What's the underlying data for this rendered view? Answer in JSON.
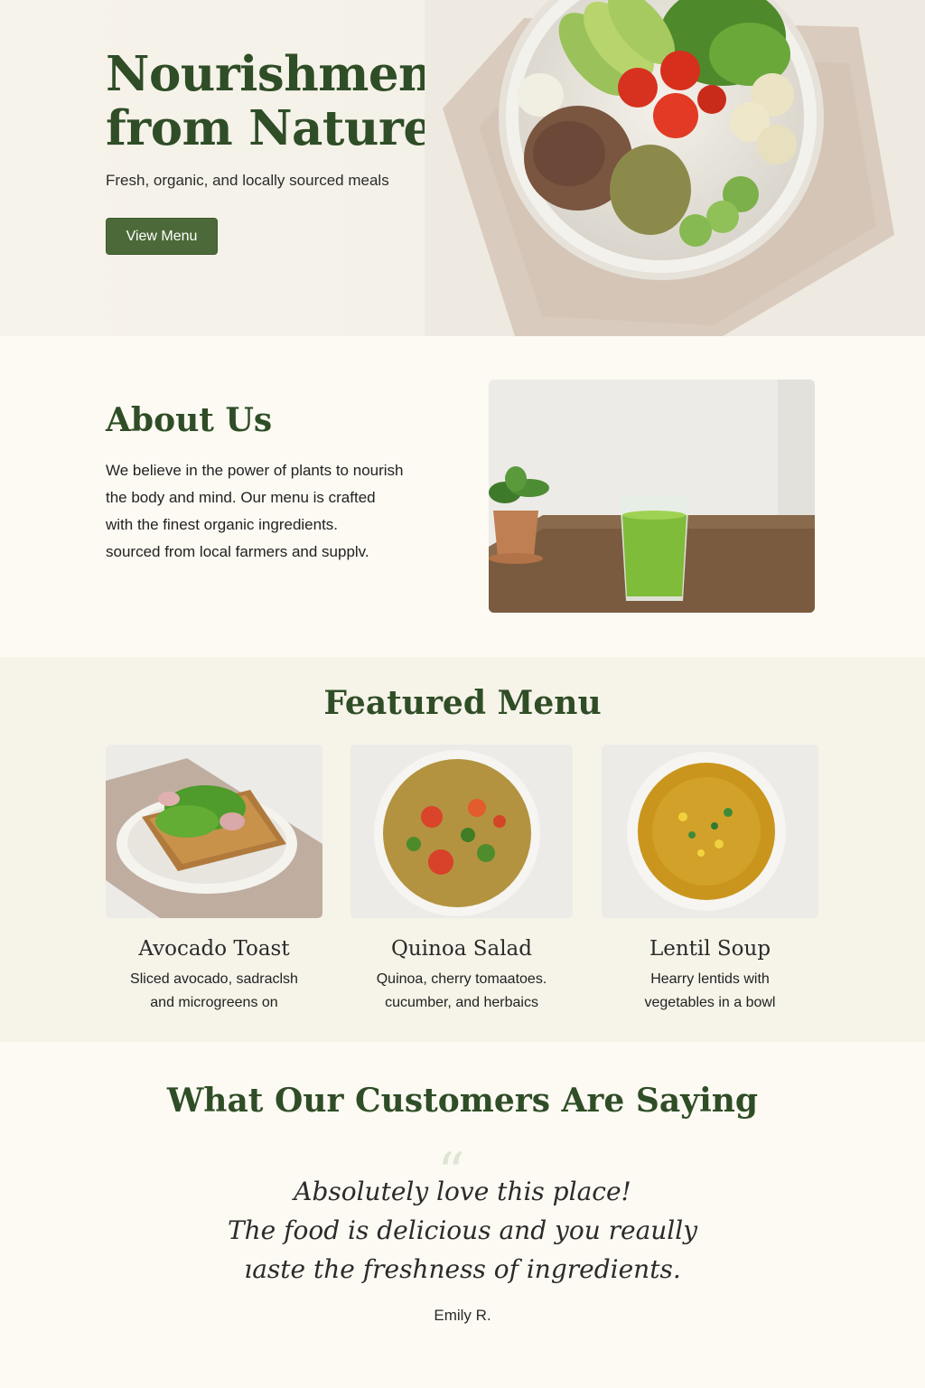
{
  "hero": {
    "title_line1": "Nourishment",
    "title_line2": "from Nature",
    "subtitle": "Fresh, organic, and locally sourced meals",
    "cta_label": "View Menu"
  },
  "about": {
    "title": "About Us",
    "lines": [
      "We believe in the power of plants to nourish",
      "the body and mind. Our menu is crafted",
      "with the finest organic ingredients.",
      "sourced from local farmers and supplv."
    ]
  },
  "menu": {
    "title": "Featured Menu",
    "items": [
      {
        "name": "Avocado Toast",
        "desc1": "Sliced avocado, sadraclsh",
        "desc2": "and microgreens on"
      },
      {
        "name": "Quinoa Salad",
        "desc1": "Quinoa, cherry tomaatoes.",
        "desc2": "cucumber, and herbaics"
      },
      {
        "name": "Lentil Soup",
        "desc1": "Hearry lentids with",
        "desc2": "vegetables in a bowl"
      }
    ]
  },
  "testimonial": {
    "title": "What Our Customers Are Saying",
    "quote_mark": "“",
    "lines": [
      "Absolutely love this place!",
      "The food is delicious and you reaully",
      "ıaste the freshness of ingredients."
    ],
    "author": "Emily R."
  },
  "colors": {
    "brand_green": "#2f4d26",
    "button_green": "#4c6a39",
    "background": "#fbf9f2"
  }
}
